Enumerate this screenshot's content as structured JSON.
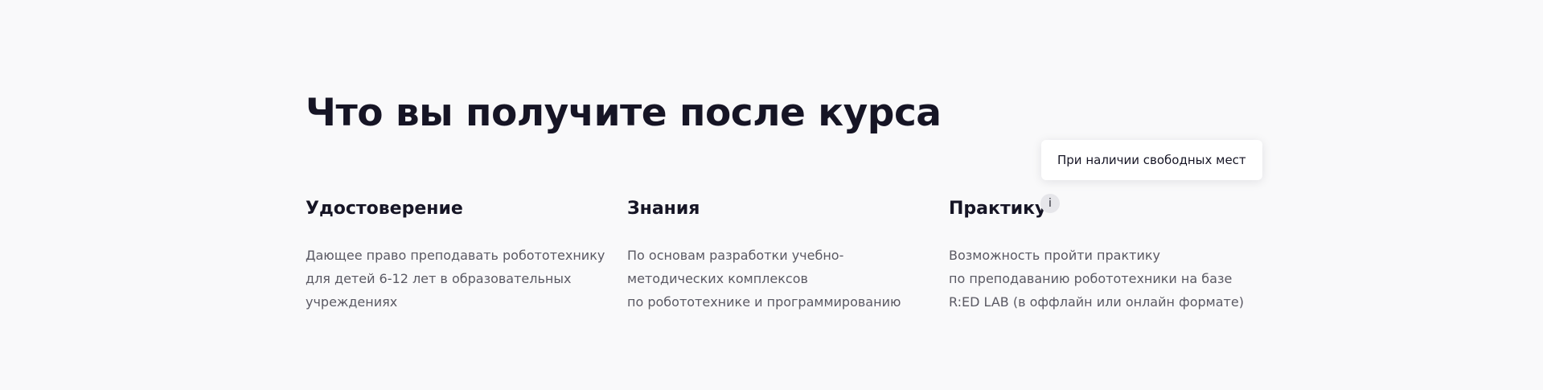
{
  "section": {
    "title": "Что вы получите после курса",
    "items": [
      {
        "title": "Удостоверение",
        "lines": [
          "Дающее право преподавать робототехнику",
          "для детей 6-12 лет в образовательных",
          "учреждениях"
        ]
      },
      {
        "title": "Знания",
        "lines": [
          "По основам разработки учебно-",
          "методических комплексов",
          "по робототехнике и программированию"
        ]
      },
      {
        "title": "Практику",
        "info_badge": "i",
        "tooltip": "При наличии свободных мест",
        "lines": [
          "Возможность пройти практику",
          "по преподаванию робототехники на базе",
          "R:ED LAB (в оффлайн или онлайн формате)"
        ]
      }
    ]
  }
}
